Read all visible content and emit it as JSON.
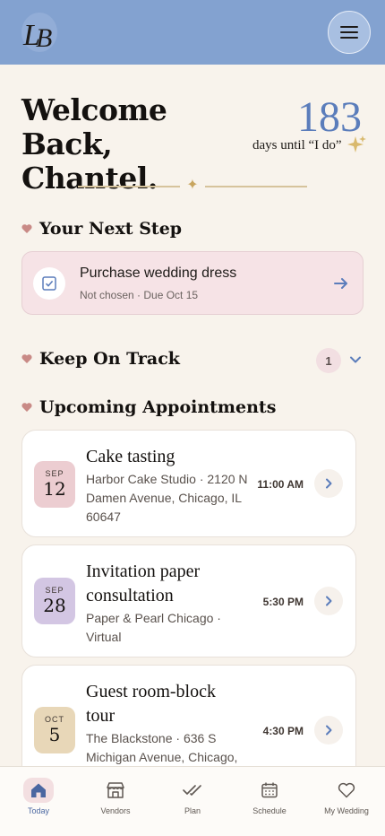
{
  "header": {
    "logo_text": "LB",
    "menu_icon": "hamburger-menu-icon"
  },
  "welcome": {
    "line1": "Welcome",
    "line2": "Back, Chantel.",
    "countdown_number": "183",
    "countdown_label": "days until “I do”"
  },
  "next_step": {
    "heading": "Your Next Step",
    "title": "Purchase wedding dress",
    "subtitle": "Not chosen · Due Oct 15"
  },
  "keep_on_track": {
    "heading": "Keep On Track",
    "count": "1"
  },
  "appointments": {
    "heading": "Upcoming Appointments",
    "items": [
      {
        "month": "SEP",
        "day": "12",
        "title": "Cake tasting",
        "address": "Harbor Cake Studio · 2120 N Damen Avenue, Chicago, IL 60647",
        "time": "11:00 AM",
        "tile_color": "#eccdd1"
      },
      {
        "month": "SEP",
        "day": "28",
        "title": "Invitation paper consultation",
        "address": "Paper & Pearl Chicago · Virtual",
        "time": "5:30 PM",
        "tile_color": "#d3c6e3"
      },
      {
        "month": "OCT",
        "day": "5",
        "title": "Guest room-block tour",
        "address": "The Blackstone · 636 S Michigan Avenue, Chicago,",
        "time": "4:30 PM",
        "tile_color": "#e8d7b8"
      }
    ]
  },
  "nav": {
    "items": [
      {
        "label": "Today",
        "icon": "home-icon",
        "active": true
      },
      {
        "label": "Vendors",
        "icon": "storefront-icon",
        "active": false
      },
      {
        "label": "Plan",
        "icon": "double-check-icon",
        "active": false
      },
      {
        "label": "Schedule",
        "icon": "calendar-icon",
        "active": false
      },
      {
        "label": "My Wedding",
        "icon": "heart-icon",
        "active": false
      }
    ]
  },
  "colors": {
    "header_bg": "#83a2d0",
    "accent_blue": "#5b7dbb",
    "pink_card": "#f6e3e6",
    "heart": "#c98a86",
    "gold": "#c8a55f"
  }
}
